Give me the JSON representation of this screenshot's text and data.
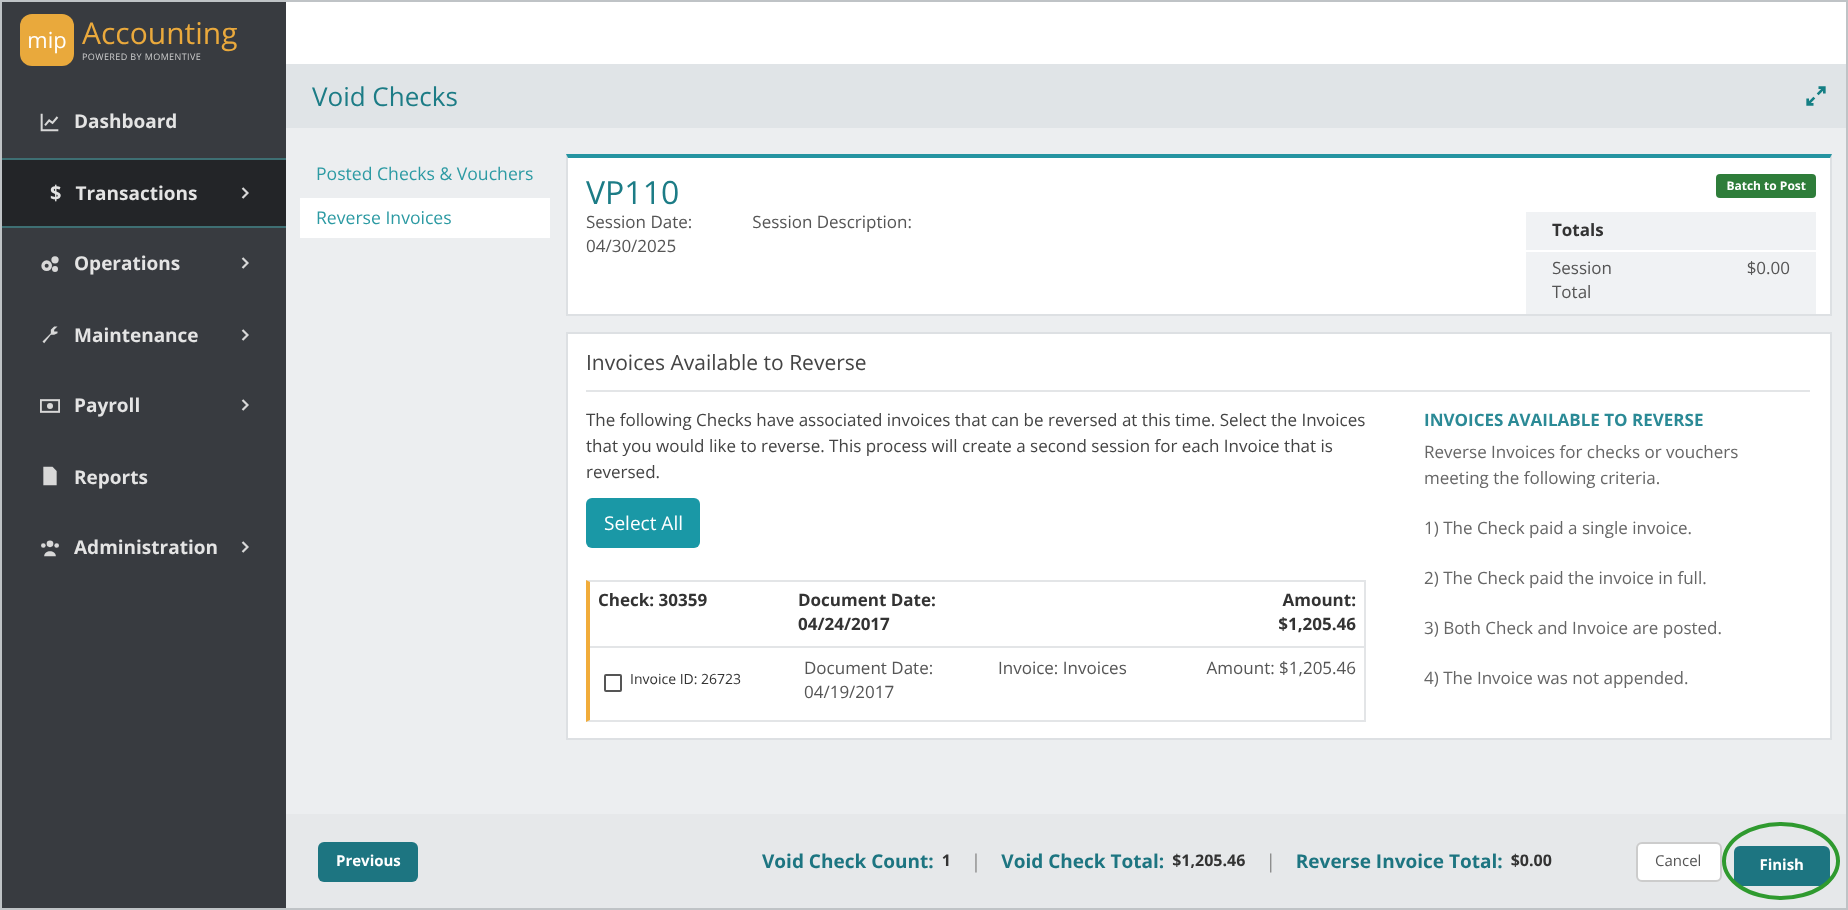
{
  "logo": {
    "badge": "mip",
    "name": "Accounting",
    "tagline": "POWERED BY MOMENTIVE"
  },
  "sidebar": {
    "items": [
      {
        "label": "Dashboard",
        "chevron": false,
        "selected": false
      },
      {
        "label": "Transactions",
        "symbol": "$",
        "chevron": true,
        "selected": true
      },
      {
        "label": "Operations",
        "chevron": true,
        "selected": false
      },
      {
        "label": "Maintenance",
        "chevron": true,
        "selected": false
      },
      {
        "label": "Payroll",
        "chevron": true,
        "selected": false
      },
      {
        "label": "Reports",
        "chevron": false,
        "selected": false
      },
      {
        "label": "Administration",
        "chevron": true,
        "selected": false
      }
    ]
  },
  "page": {
    "title": "Void Checks"
  },
  "subnav": [
    {
      "label": "Posted Checks & Vouchers",
      "selected": false
    },
    {
      "label": "Reverse Invoices",
      "selected": true
    }
  ],
  "session": {
    "id": "VP110",
    "status": "Batch to Post",
    "date_label": "Session Date:",
    "date": "04/30/2025",
    "description_label": "Session Description:",
    "totals_title": "Totals",
    "total_label": "Session Total",
    "total_value": "$0.00"
  },
  "invoices": {
    "title": "Invoices Available to Reverse",
    "intro": "The following Checks have associated invoices that can be reversed at this time. Select the Invoices that you would like to reverse. This process will create a second session for each Invoice that is reversed.",
    "select_all": "Select All",
    "checks": [
      {
        "check": "Check: 30359",
        "doc_date_label": "Document Date:",
        "doc_date": "04/24/2017",
        "amount_label": "Amount:",
        "amount": "$1,205.46",
        "lines": [
          {
            "checked": false,
            "invoice_id": "Invoice ID: 26723",
            "doc_date_label": "Document Date:",
            "doc_date": "04/19/2017",
            "invoice": "Invoice: Invoices",
            "amount": "Amount: $1,205.46"
          }
        ]
      }
    ],
    "help": {
      "title": "INVOICES AVAILABLE TO REVERSE",
      "intro": "Reverse Invoices for checks or vouchers meeting the following criteria.",
      "criteria": [
        "1) The Check paid a single invoice.",
        "2) The Check paid the invoice in full.",
        "3) Both Check and Invoice are posted.",
        "4) The Invoice was not appended."
      ]
    }
  },
  "footer": {
    "previous": "Previous",
    "stats": [
      {
        "label": "Void Check Count:",
        "value": "1"
      },
      {
        "label": "Void Check Total:",
        "value": "$1,205.46"
      },
      {
        "label": "Reverse Invoice Total:",
        "value": "$0.00"
      }
    ],
    "separator": "|",
    "cancel": "Cancel",
    "finish": "Finish",
    "finish_circled": true
  }
}
